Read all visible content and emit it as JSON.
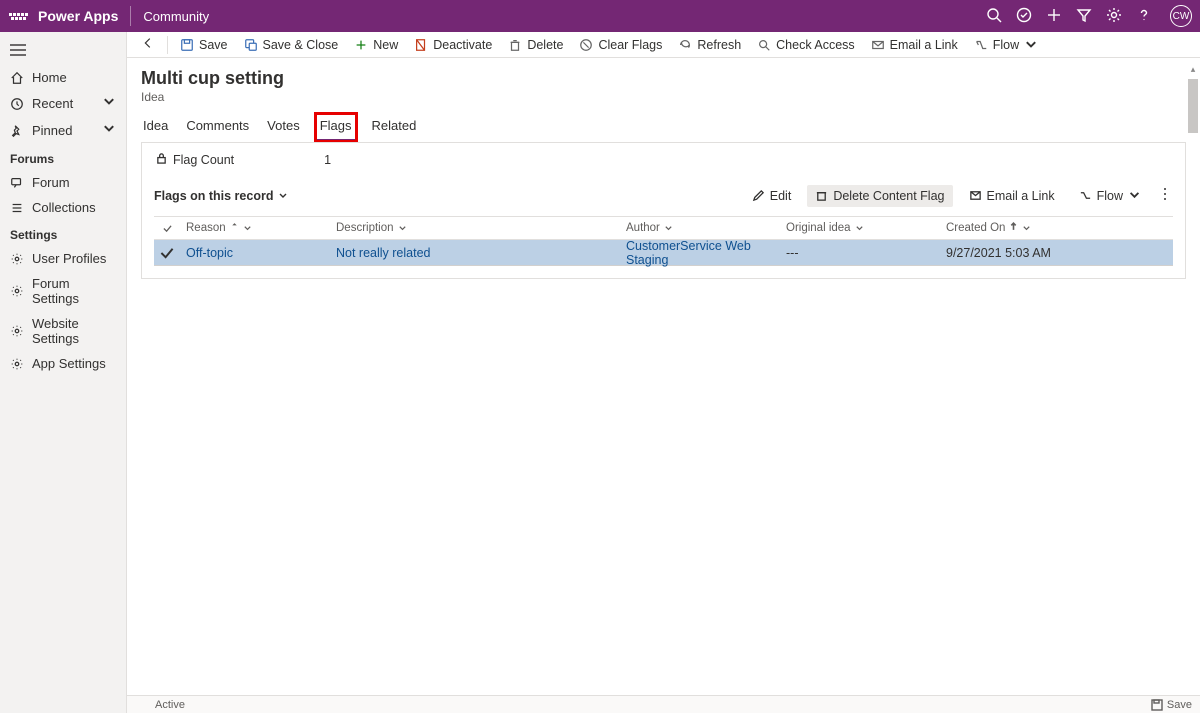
{
  "topbar": {
    "app_title": "Power Apps",
    "env_name": "Community",
    "avatar_initials": "CW"
  },
  "sidebar": {
    "home": "Home",
    "recent": "Recent",
    "pinned": "Pinned",
    "group_forums": "Forums",
    "forum": "Forum",
    "collections": "Collections",
    "group_settings": "Settings",
    "user_profiles": "User Profiles",
    "forum_settings": "Forum Settings",
    "website_settings": "Website Settings",
    "app_settings": "App Settings"
  },
  "cmdbar": {
    "save": "Save",
    "save_close": "Save & Close",
    "new": "New",
    "deactivate": "Deactivate",
    "delete": "Delete",
    "clear_flags": "Clear Flags",
    "refresh": "Refresh",
    "check_access": "Check Access",
    "email_link": "Email a Link",
    "flow": "Flow"
  },
  "page": {
    "title": "Multi cup setting",
    "subtitle": "Idea"
  },
  "tabs": {
    "idea": "Idea",
    "comments": "Comments",
    "votes": "Votes",
    "flags": "Flags",
    "related": "Related"
  },
  "flagcount": {
    "label": "Flag Count",
    "value": "1"
  },
  "subgrid": {
    "title": "Flags on this record",
    "edit": "Edit",
    "delete_flag": "Delete Content Flag",
    "email_link": "Email a Link",
    "flow": "Flow",
    "columns": {
      "reason": "Reason",
      "description": "Description",
      "author": "Author",
      "original_idea": "Original idea",
      "created_on": "Created On"
    },
    "rows": [
      {
        "reason": "Off-topic",
        "description": "Not really related",
        "author": "CustomerService Web Staging",
        "original_idea": "---",
        "created_on": "9/27/2021 5:03 AM"
      }
    ]
  },
  "statusbar": {
    "active": "Active",
    "save": "Save"
  }
}
